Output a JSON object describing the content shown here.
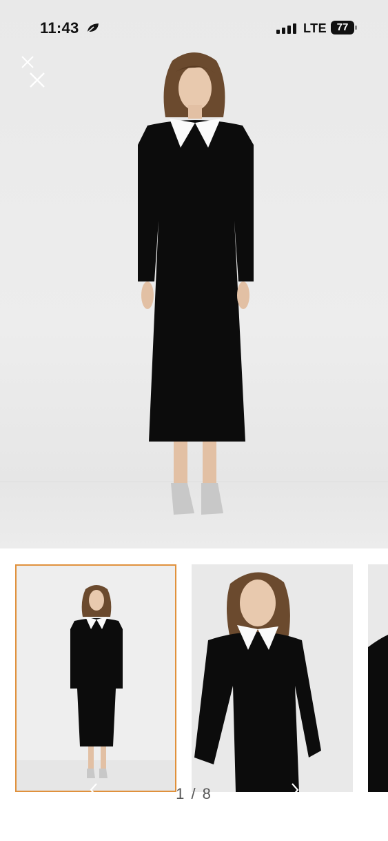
{
  "status_bar": {
    "time": "11:43",
    "network": "LTE",
    "battery": "77"
  },
  "icons": {
    "focus": "leaf-icon",
    "signal": "signal-bars-icon",
    "close": "close-icon",
    "prev": "chevron-left-icon",
    "next": "chevron-right-icon"
  },
  "gallery": {
    "counter": "1 / 8",
    "selected_thumb_color": "#e0913c",
    "thumbnails": [
      {
        "label": "full-length front view",
        "selected": true
      },
      {
        "label": "close-up collar view",
        "selected": false
      },
      {
        "label": "side detail view",
        "selected": false
      }
    ]
  }
}
